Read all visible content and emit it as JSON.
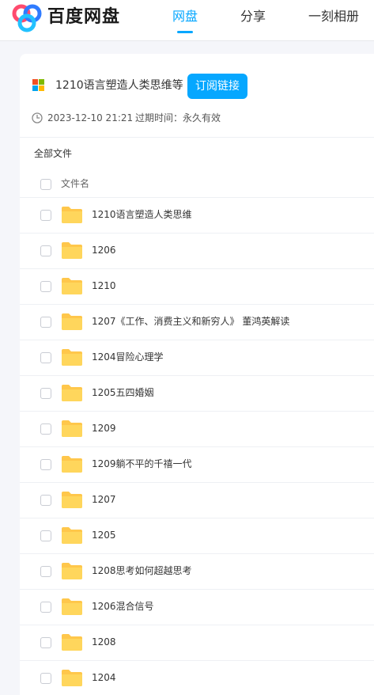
{
  "header": {
    "brand": "百度网盘",
    "nav": [
      {
        "label": "网盘",
        "active": true
      },
      {
        "label": "分享",
        "active": false
      },
      {
        "label": "一刻相册",
        "active": false
      }
    ],
    "accent_color": "#06a7ff"
  },
  "share": {
    "title": "1210语言塑造人类思维等",
    "subscribe_label": "订阅链接",
    "date": "2023-12-10 21:21",
    "expire_label": "过期时间：",
    "expire_value": "永久有效"
  },
  "breadcrumb": "全部文件",
  "table": {
    "column_header": "文件名",
    "files": [
      {
        "name": "1210语言塑造人类思维",
        "icon": "folder-icon"
      },
      {
        "name": "1206",
        "icon": "folder-icon"
      },
      {
        "name": "1210",
        "icon": "folder-icon"
      },
      {
        "name": "1207《工作、消费主义和新穷人》 董鸿英解读",
        "icon": "folder-icon"
      },
      {
        "name": "1204冒险心理学",
        "icon": "folder-icon"
      },
      {
        "name": "1205五四婚姻",
        "icon": "folder-icon"
      },
      {
        "name": "1209",
        "icon": "folder-icon"
      },
      {
        "name": "1209躺不平的千禧一代",
        "icon": "folder-icon"
      },
      {
        "name": "1207",
        "icon": "folder-icon"
      },
      {
        "name": "1205",
        "icon": "folder-icon"
      },
      {
        "name": "1208思考如何超越思考",
        "icon": "folder-icon"
      },
      {
        "name": "1206混合信号",
        "icon": "folder-icon"
      },
      {
        "name": "1208",
        "icon": "folder-icon"
      },
      {
        "name": "1204",
        "icon": "folder-icon"
      }
    ]
  }
}
